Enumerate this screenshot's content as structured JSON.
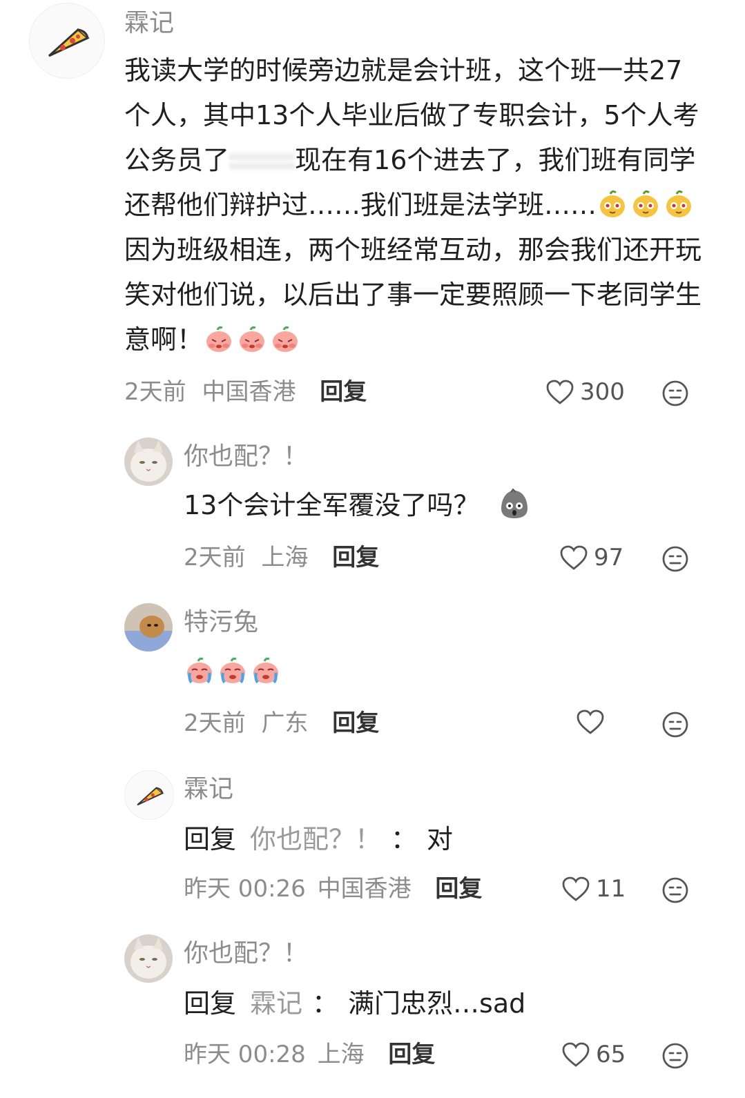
{
  "comments": [
    {
      "author": "霖记",
      "text_parts": [
        "我读大学的时候旁边就是会计班，这个班一共27个人，其中13个人毕业后做了专职会计，5个人考公务员了",
        "现在有16个进去了，我们班有同学还帮他们辩护过……我们班是法学班……",
        "因为班级相连，两个班经常互动，那会我们还开玩笑对他们说，以后出了事一定要照顾一下老同学生意啊！"
      ],
      "time": "2天前",
      "location": "中国香港",
      "reply_label": "回复",
      "likes": "300"
    },
    {
      "author": "你也配？！",
      "text": "13个会计全军覆没了吗？",
      "time": "2天前",
      "location": "上海",
      "reply_label": "回复",
      "likes": "97"
    },
    {
      "author": "特污兔",
      "time": "2天前",
      "location": "广东",
      "reply_label": "回复",
      "likes": ""
    },
    {
      "author": "霖记",
      "reply_word": "回复",
      "reply_to": "你也配？！",
      "reply_sep": "：",
      "reply_text": "对",
      "time": "昨天 00:26",
      "location": "中国香港",
      "reply_label": "回复",
      "likes": "11"
    },
    {
      "author": "你也配？！",
      "reply_word": "回复",
      "reply_to": "霖记",
      "reply_sep": "：",
      "reply_text": "满门忠烈…sad",
      "time": "昨天 00:28",
      "location": "上海",
      "reply_label": "回复",
      "likes": "65"
    }
  ],
  "icons": {
    "like": "heart-outline-icon",
    "dislike": "neutral-face-icon",
    "emoji_smirk": "yellow-pear-emoji",
    "emoji_shy": "pink-peach-shy-emoji",
    "emoji_cry": "pink-peach-cry-emoji",
    "emoji_shock": "gray-shock-emoji"
  },
  "colors": {
    "text": "#1f1f1f",
    "muted": "#8c8c8c",
    "background": "#ffffff"
  }
}
